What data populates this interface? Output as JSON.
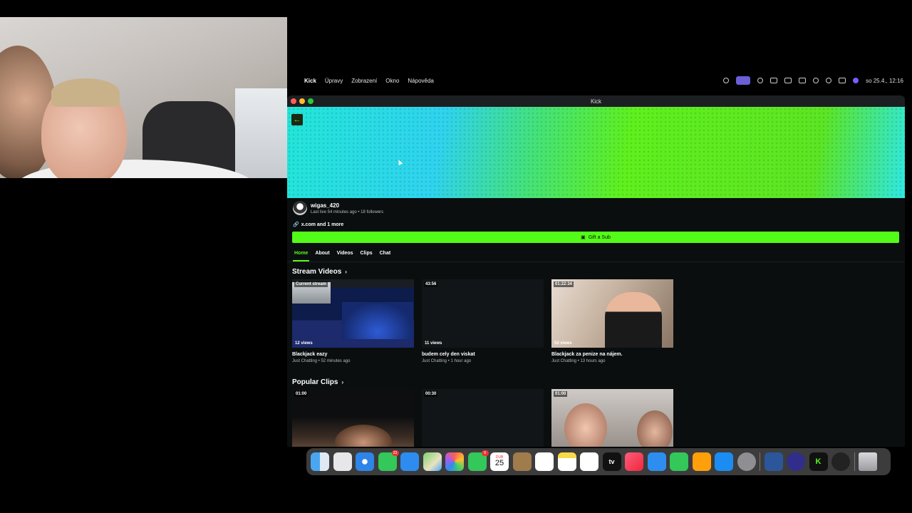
{
  "menubar": {
    "app_name": "Kick",
    "items": [
      "Úpravy",
      "Zobrazení",
      "Okno",
      "Nápověda"
    ],
    "clock": "so 25.4., 12:16"
  },
  "window": {
    "title": "Kick"
  },
  "channel": {
    "username": "wigas_420",
    "meta": "Last live 54 minutes ago • 18 followers",
    "links": "x.com and 1 more",
    "gift_label": "Gift a Sub"
  },
  "tabs": [
    {
      "label": "Home",
      "active": true
    },
    {
      "label": "About"
    },
    {
      "label": "Videos"
    },
    {
      "label": "Clips"
    },
    {
      "label": "Chat"
    }
  ],
  "stream_videos": {
    "title": "Stream Videos",
    "items": [
      {
        "tag": "Current stream",
        "views": "12 views",
        "title": "Blackjack eazy",
        "meta": "Just Chatting • 52 minutes ago"
      },
      {
        "tag": "43:56",
        "views": "11 views",
        "title": "budem cely den viskat",
        "meta": "Just Chatting • 1 hour ago"
      },
      {
        "tag": "01:22:34",
        "views": "53 views",
        "title": "Blackjack za penize na nájem.",
        "meta": "Just Chatting • 13 hours ago"
      }
    ]
  },
  "popular_clips": {
    "title": "Popular Clips",
    "items": [
      {
        "tag": "01:00"
      },
      {
        "tag": "00:30"
      },
      {
        "tag": "01:00"
      }
    ]
  },
  "dock": {
    "apps": [
      "finder-icon",
      "launchpad-icon",
      "safari-icon",
      "messages-icon",
      "mail-icon",
      "maps-icon",
      "photos-icon",
      "facetime-icon",
      "calendar-icon",
      "contacts-icon",
      "reminders-icon",
      "notes-icon",
      "freeform-icon",
      "tv-icon",
      "music-icon",
      "keynote-icon",
      "numbers-icon",
      "pages-icon",
      "app-store-icon",
      "system-settings-icon",
      "word-icon",
      "obs-icon",
      "kick-icon",
      "chatgpt-icon",
      "trash-icon"
    ],
    "messages_badge": "23",
    "facetime_badge": "9",
    "calendar_month": "DUB",
    "calendar_day": "25",
    "tv_label": "tv"
  },
  "colors": {
    "kick_green": "#53fc18",
    "background": "#0b0e0f"
  }
}
